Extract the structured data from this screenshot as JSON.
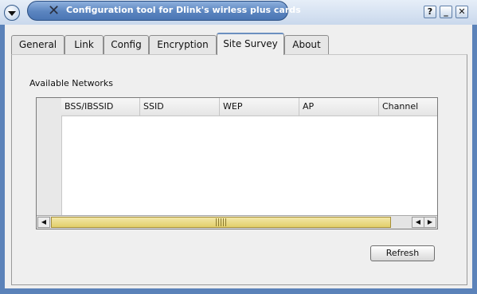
{
  "window": {
    "title": "Configuration tool for Dlink's wirless plus cards",
    "title_icon": "x-app-icon",
    "controls": {
      "help_label": "?",
      "minimize_label": "_",
      "close_label": "✕"
    }
  },
  "tabs": [
    {
      "label": "General",
      "active": false
    },
    {
      "label": "Link",
      "active": false
    },
    {
      "label": "Config",
      "active": false
    },
    {
      "label": "Encryption",
      "active": false
    },
    {
      "label": "Site Survey",
      "active": true
    },
    {
      "label": "About",
      "active": false
    }
  ],
  "site_survey": {
    "section_label": "Available Networks",
    "columns": [
      "BSS/IBSSID",
      "SSID",
      "WEP",
      "AP",
      "Channel"
    ],
    "rows": [],
    "refresh_label": "Refresh"
  },
  "colors": {
    "titlebar_accent": "#5a84bf",
    "window_frame": "#5b82b9",
    "scrollbar_slider": "#e2cf6a"
  }
}
